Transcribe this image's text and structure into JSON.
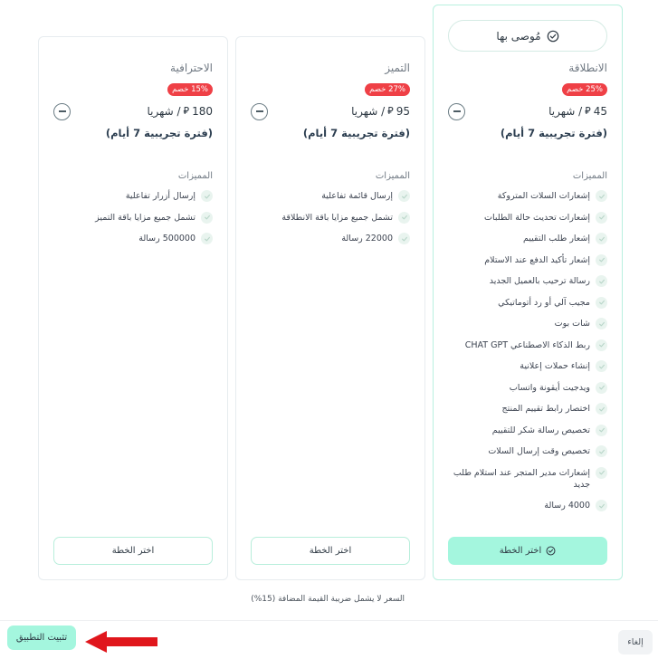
{
  "recommended_label": "مُوصى بها",
  "features_title": "المميزات",
  "choose_label": "اختر الخطة",
  "trial_label": "(فترة تجريبية 7 أيام)",
  "price_suffix": "/ شهريا",
  "currency_icon": "riyal-icon",
  "plans": [
    {
      "name": "الانطلاقة",
      "discount": "25% خصم",
      "price": "45",
      "features": [
        "إشعارات السلات المتروكة",
        "إشعارات تحديث حالة الطلبات",
        "إشعار طلب التقييم",
        "إشعار تأكيد الدفع عند الاستلام",
        "رسالة ترحيب بالعميل الجديد",
        "مجيب آلي أو رد أتوماتيكي",
        "شات بوت",
        "ربط الذكاء الاصطناعي CHAT GPT",
        "إنشاء حملات إعلانية",
        "ويدجيت أيقونة واتساب",
        "اختصار رابط تقييم المنتج",
        "تخصيص رسالة شكر للتقييم",
        "تخصيص وقت إرسال السلات",
        "إشعارات مدير المتجر عند استلام طلب جديد",
        "4000 رسالة"
      ]
    },
    {
      "name": "التميز",
      "discount": "27% خصم",
      "price": "95",
      "features": [
        "إرسال قائمة تفاعلية",
        "تشمل جميع مزايا باقة الانطلاقة",
        "22000 رسالة"
      ]
    },
    {
      "name": "الاحترافية",
      "discount": "15% خصم",
      "price": "180",
      "features": [
        "إرسال أزرار تفاعلية",
        "تشمل جميع مزايا باقة التميز",
        "500000 رسالة"
      ]
    }
  ],
  "vat_note": "السعر لا يشمل ضريبة القيمة المضافة (15%)",
  "footer": {
    "install_label": "تثبيت التطبيق",
    "cancel_label": "إلغاء"
  },
  "colors": {
    "accent": "#a4f6de",
    "discount": "#ef4046",
    "arrow": "#e0161c"
  }
}
